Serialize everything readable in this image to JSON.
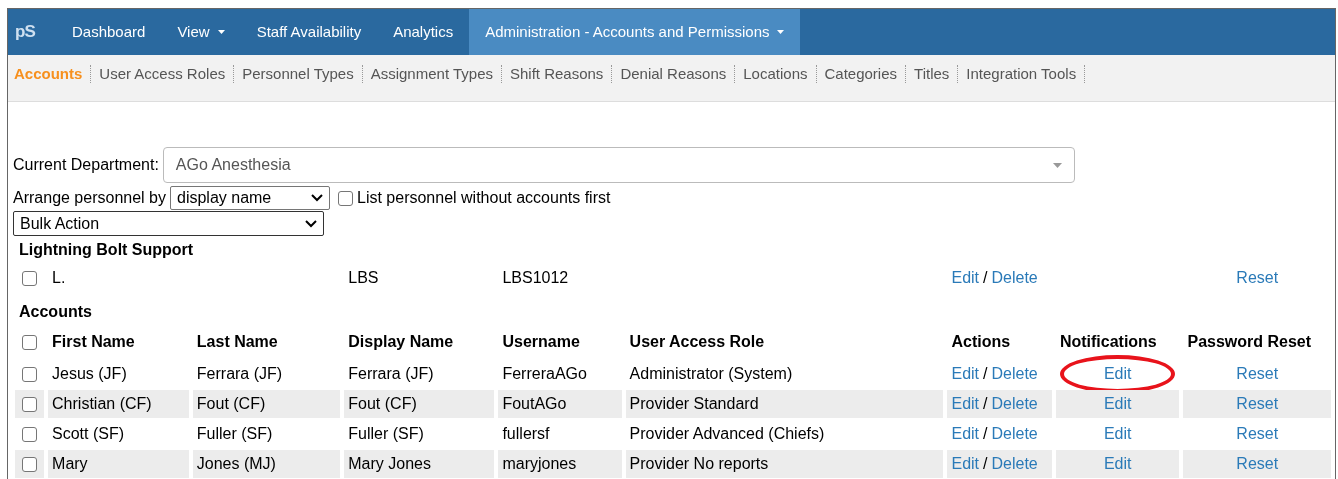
{
  "logo": "pS",
  "nav": [
    {
      "label": "Dashboard",
      "dropdown": false,
      "selected": false
    },
    {
      "label": "View",
      "dropdown": true,
      "selected": false
    },
    {
      "label": "Staff Availability",
      "dropdown": false,
      "selected": false
    },
    {
      "label": "Analytics",
      "dropdown": false,
      "selected": false
    },
    {
      "label": "Administration - Accounts and Permissions",
      "dropdown": true,
      "selected": true
    }
  ],
  "subnav": [
    {
      "label": "Accounts",
      "selected": true
    },
    {
      "label": "User Access Roles",
      "selected": false
    },
    {
      "label": "Personnel Types",
      "selected": false
    },
    {
      "label": "Assignment Types",
      "selected": false
    },
    {
      "label": "Shift Reasons",
      "selected": false
    },
    {
      "label": "Denial Reasons",
      "selected": false
    },
    {
      "label": "Locations",
      "selected": false
    },
    {
      "label": "Categories",
      "selected": false
    },
    {
      "label": "Titles",
      "selected": false
    },
    {
      "label": "Integration Tools",
      "selected": false
    }
  ],
  "department": {
    "label": "Current Department:",
    "value": "AGo Anesthesia"
  },
  "arrange": {
    "label": "Arrange personnel by",
    "value": "display name",
    "checkbox_label": "List personnel without accounts first",
    "checked": false
  },
  "bulk_action": {
    "value": "Bulk Action"
  },
  "support_group": {
    "title": "Lightning Bolt Support",
    "rows": [
      {
        "checked": false,
        "first": "L.",
        "display": "LBS",
        "username": "LBS1012",
        "edit": "Edit",
        "separator": "/",
        "delete": "Delete",
        "reset": "Reset"
      }
    ]
  },
  "accounts": {
    "title": "Accounts",
    "header_checked": false,
    "columns": [
      "First Name",
      "Last Name",
      "Display Name",
      "Username",
      "User Access Role",
      "Actions",
      "Notifications",
      "Password Reset"
    ],
    "rows": [
      {
        "checked": false,
        "first": "Jesus (JF)",
        "last": "Ferrara (JF)",
        "display": "Ferrara (JF)",
        "username": "FerreraAGo",
        "role": "Administrator (System)",
        "edit": "Edit",
        "separator": "/",
        "delete": "Delete",
        "notifications": "Edit",
        "reset": "Reset",
        "circled": true
      },
      {
        "checked": false,
        "first": "Christian (CF)",
        "last": "Fout (CF)",
        "display": "Fout (CF)",
        "username": "FoutAGo",
        "role": "Provider Standard",
        "edit": "Edit",
        "separator": "/",
        "delete": "Delete",
        "notifications": "Edit",
        "reset": "Reset",
        "circled": false
      },
      {
        "checked": false,
        "first": "Scott (SF)",
        "last": "Fuller (SF)",
        "display": "Fuller (SF)",
        "username": "fullersf",
        "role": "Provider Advanced (Chiefs)",
        "edit": "Edit",
        "separator": "/",
        "delete": "Delete",
        "notifications": "Edit",
        "reset": "Reset",
        "circled": false
      },
      {
        "checked": false,
        "first": "Mary",
        "last": "Jones (MJ)",
        "display": "Mary Jones",
        "username": "maryjones",
        "role": "Provider No reports",
        "edit": "Edit",
        "separator": "/",
        "delete": "Delete",
        "notifications": "Edit",
        "reset": "Reset",
        "circled": false
      }
    ]
  }
}
